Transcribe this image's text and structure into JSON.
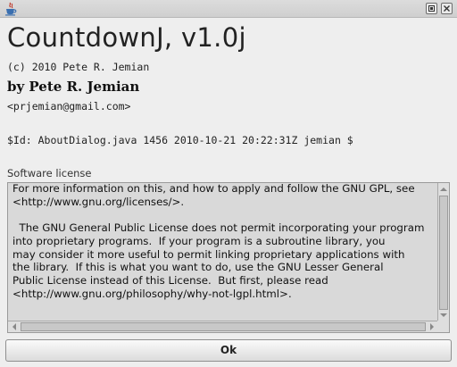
{
  "window": {
    "icon": "java-cup-icon",
    "controls": [
      "restore-icon",
      "close-icon"
    ]
  },
  "about": {
    "title": "CountdownJ, v1.0j",
    "copyright": "(c) 2010 Pete R. Jemian",
    "byline": "by Pete R. Jemian",
    "email": "<prjemian@gmail.com>",
    "svn_id": "$Id: AboutDialog.java 1456 2010-10-21 20:22:31Z jemian $"
  },
  "license": {
    "label": "Software license",
    "text": "For more information on this, and how to apply and follow the GNU GPL, see\n<http://www.gnu.org/licenses/>.\n\n  The GNU General Public License does not permit incorporating your program\ninto proprietary programs.  If your program is a subroutine library, you\nmay consider it more useful to permit linking proprietary applications with\nthe library.  If this is what you want to do, use the GNU Lesser General\nPublic License instead of this License.  But first, please read\n<http://www.gnu.org/philosophy/why-not-lgpl.html>."
  },
  "buttons": {
    "ok": "Ok"
  }
}
